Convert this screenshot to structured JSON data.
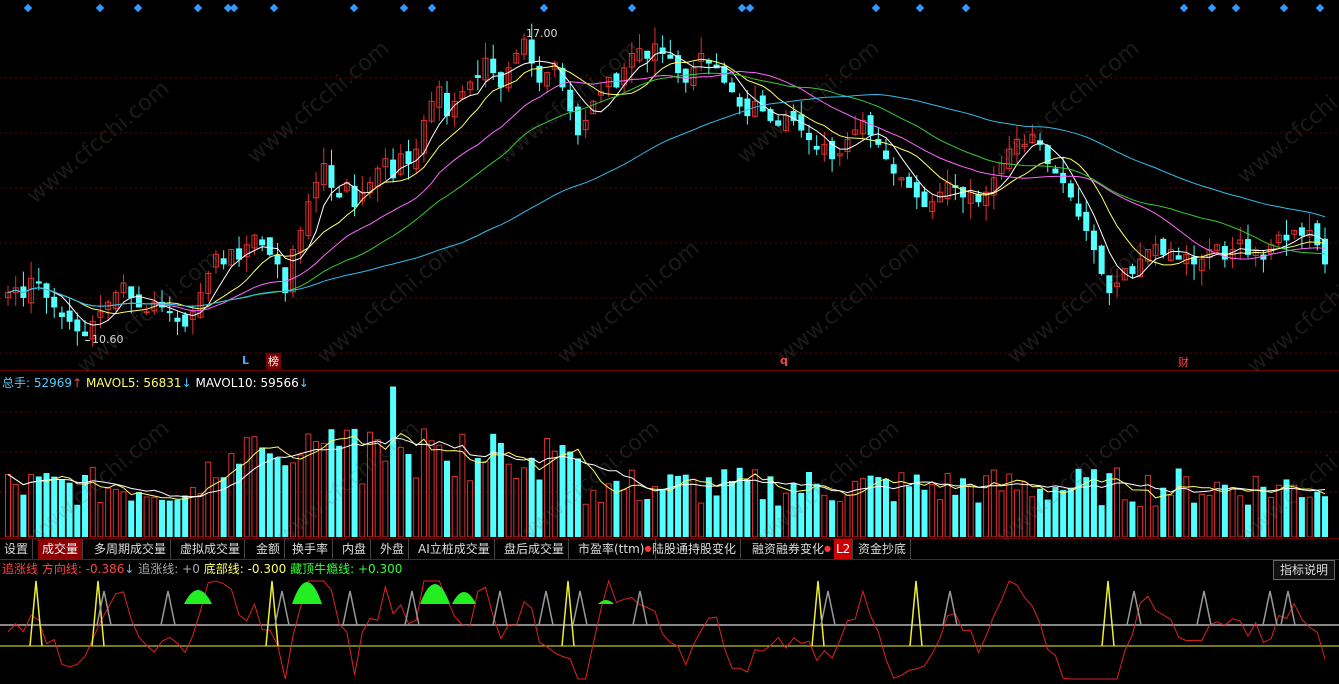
{
  "colors": {
    "up": "#e03030",
    "down": "#54ffff",
    "ma5": "#ffffff",
    "ma10": "#ffff66",
    "ma20": "#ff66ff",
    "ma30": "#33cc33",
    "ma60": "#33bbee",
    "grid": "#6b0000",
    "marker": "#3399ff"
  },
  "price_panel": {
    "high_label": "17.00",
    "low_label": "10.60",
    "markers": [
      "L",
      "榜",
      "q",
      "财"
    ]
  },
  "volume_panel": {
    "legend": {
      "total_label": "总手:",
      "total_value": "52969",
      "total_arrow": "↑",
      "mavol5_label": "MAVOL5:",
      "mavol5_value": "56831",
      "mavol5_arrow": "↓",
      "mavol10_label": "MAVOL10:",
      "mavol10_value": "59566",
      "mavol10_arrow": "↓"
    }
  },
  "tabs": [
    {
      "label": "设置"
    },
    {
      "label": "成交量",
      "active": true
    },
    {
      "label": "多周期成交量"
    },
    {
      "label": "虚拟成交量"
    },
    {
      "label": "金额"
    },
    {
      "label": "换手率"
    },
    {
      "label": "内盘"
    },
    {
      "label": "外盘"
    },
    {
      "label": "AI立桩成交量"
    },
    {
      "label": "盘后成交量"
    },
    {
      "label": "市盈率(ttm)",
      "dot": true
    },
    {
      "label": "陆股通持股变化"
    },
    {
      "label": "融资融券变化",
      "dot": true
    },
    {
      "label": "L2",
      "badge": true
    },
    {
      "label": "资金抄底"
    }
  ],
  "indicator_panel": {
    "legend": {
      "l1": "追涨线",
      "l2": "方向线:",
      "v2": "-0.386",
      "a2": "↓",
      "l3": "追涨线:",
      "v3": "+0",
      "l4": "底部线:",
      "v4": "-0.300",
      "l5": "藏顶牛瘾线:",
      "v5": "+0.300"
    },
    "help_button": "指标说明"
  },
  "watermark": "www.cfcchi.com",
  "chart_data": {
    "type": "candlestick",
    "high": 17.0,
    "low": 10.6,
    "ylim": [
      10.4,
      17.3
    ],
    "closes": [
      11.6,
      11.7,
      11.5,
      11.9,
      11.8,
      11.5,
      11.3,
      11.1,
      11.0,
      10.8,
      10.7,
      11.0,
      11.2,
      11.4,
      11.6,
      11.8,
      11.5,
      11.3,
      11.2,
      11.4,
      11.3,
      11.2,
      11.0,
      10.9,
      11.2,
      11.6,
      12.0,
      12.4,
      12.2,
      12.5,
      12.3,
      12.6,
      12.8,
      12.6,
      12.4,
      12.2,
      11.6,
      12.5,
      12.9,
      13.5,
      13.9,
      14.3,
      13.8,
      13.6,
      13.9,
      13.4,
      13.7,
      13.9,
      14.2,
      14.4,
      14.0,
      14.5,
      14.3,
      14.6,
      15.2,
      15.6,
      15.9,
      15.3,
      15.6,
      15.8,
      16.0,
      16.1,
      16.5,
      16.2,
      15.9,
      16.3,
      16.6,
      16.9,
      16.4,
      16.0,
      16.2,
      16.4,
      15.9,
      15.4,
      14.9,
      15.2,
      15.6,
      15.8,
      16.1,
      15.9,
      16.3,
      16.6,
      16.7,
      16.5,
      16.8,
      16.6,
      16.5,
      16.2,
      16.0,
      16.3,
      16.6,
      16.4,
      16.3,
      16.0,
      15.8,
      15.5,
      15.3,
      15.6,
      15.4,
      15.2,
      15.1,
      15.3,
      15.2,
      15.0,
      14.8,
      14.6,
      14.7,
      14.4,
      14.5,
      14.8,
      15.0,
      15.2,
      14.9,
      14.7,
      14.4,
      14.1,
      14.0,
      13.8,
      13.6,
      13.4,
      13.5,
      13.7,
      13.9,
      13.8,
      13.6,
      13.7,
      13.5,
      13.7,
      14.0,
      14.3,
      14.6,
      14.8,
      14.7,
      14.9,
      14.7,
      14.3,
      14.1,
      13.9,
      13.6,
      13.2,
      12.9,
      12.5,
      12.0,
      11.6,
      11.8,
      12.1,
      12.0,
      12.3,
      12.5,
      12.6,
      12.4,
      12.5,
      12.3,
      12.4,
      12.2,
      12.3,
      12.5,
      12.6,
      12.3,
      12.5,
      12.7,
      12.4,
      12.5,
      12.3,
      12.6,
      12.8,
      12.7,
      12.9,
      12.8,
      12.9,
      12.6,
      12.2
    ]
  }
}
